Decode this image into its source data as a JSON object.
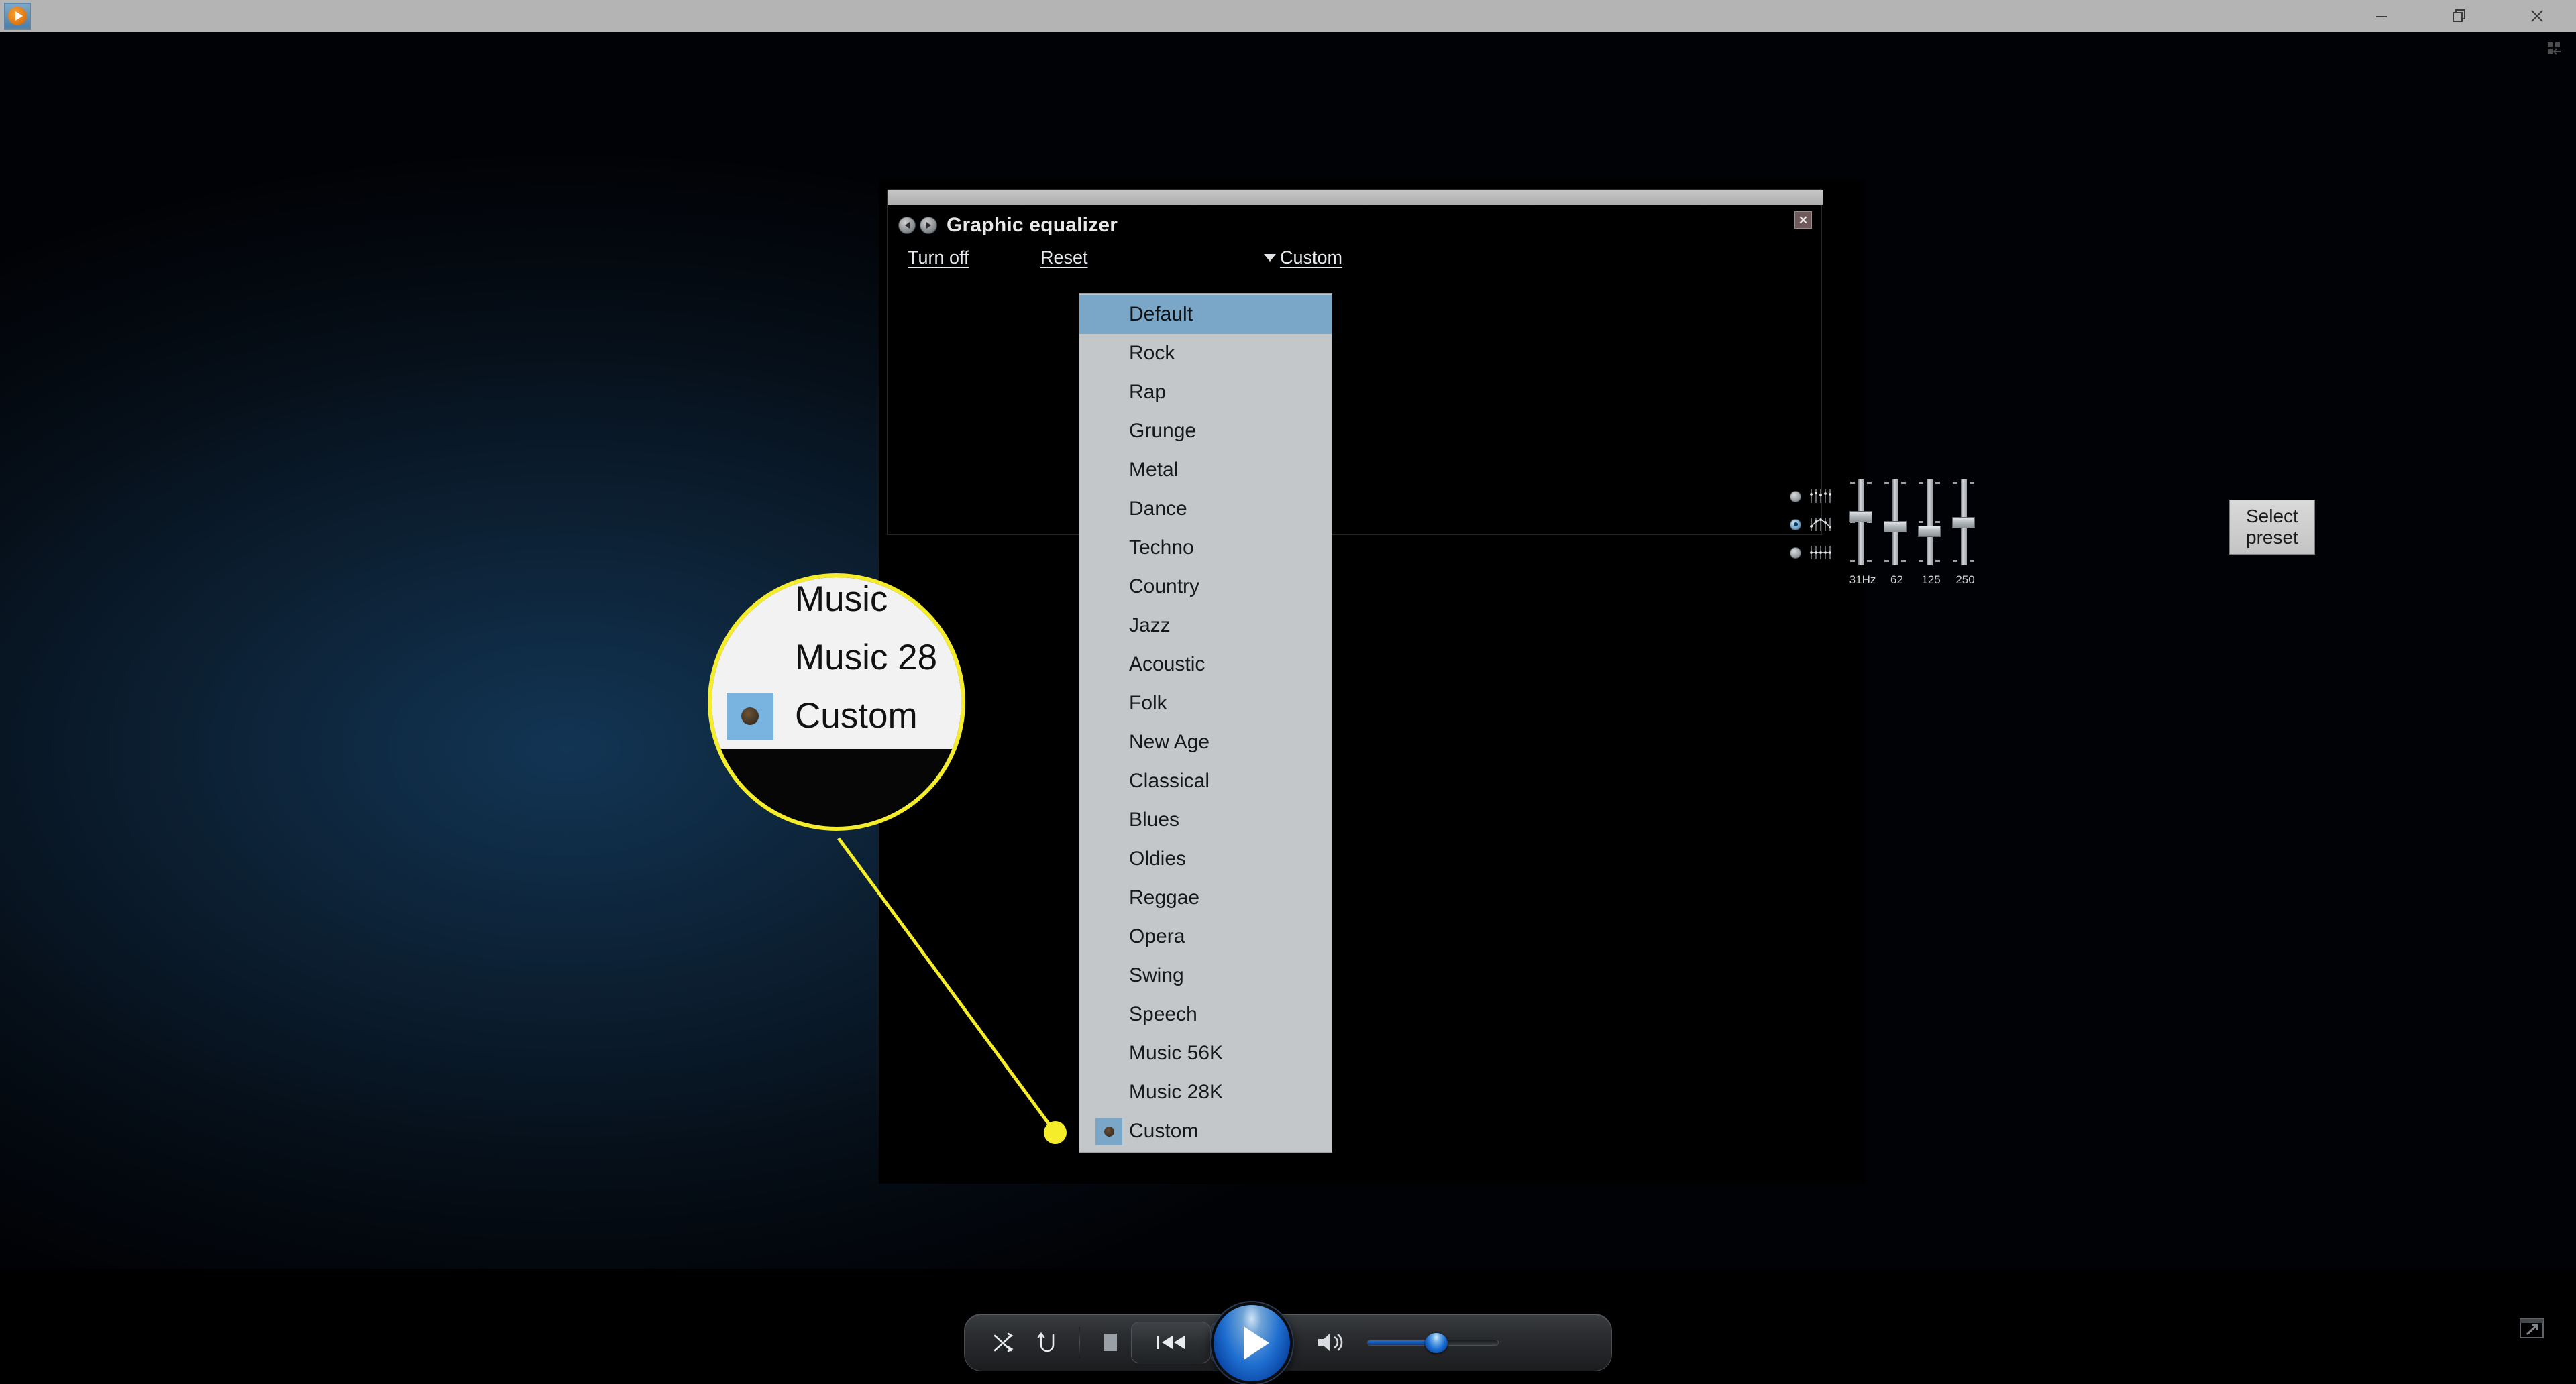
{
  "titlebar": {
    "app_icon": "media-player-icon",
    "minimize_label": "—",
    "restore_label": "❐",
    "close_label": "✕"
  },
  "equalizer": {
    "title": "Graphic equalizer",
    "nav_prev_icon": "chevron-left-circle-icon",
    "nav_next_icon": "chevron-right-circle-icon",
    "close_label": "✕",
    "turn_off_label": "Turn off",
    "reset_label": "Reset",
    "selected_preset": "Custom",
    "select_preset_button": "Select preset",
    "mode_radios": [
      {
        "name": "independent-sliders",
        "selected": false
      },
      {
        "name": "loose-sliders",
        "selected": true
      },
      {
        "name": "tight-sliders",
        "selected": false
      }
    ],
    "bands": [
      {
        "label": "31Hz",
        "thumb_pct": 42
      },
      {
        "label": "62",
        "thumb_pct": 55
      },
      {
        "label": "125",
        "thumb_pct": 62
      },
      {
        "label": "250",
        "thumb_pct": 50
      }
    ]
  },
  "preset_dropdown": {
    "highlighted": "Default",
    "checked": "Custom",
    "items": [
      "Default",
      "Rock",
      "Rap",
      "Grunge",
      "Metal",
      "Dance",
      "Techno",
      "Country",
      "Jazz",
      "Acoustic",
      "Folk",
      "New Age",
      "Classical",
      "Blues",
      "Oldies",
      "Reggae",
      "Opera",
      "Swing",
      "Speech",
      "Music 56K",
      "Music 28K",
      "Custom"
    ]
  },
  "callout": {
    "line1": "Music",
    "line2": "Music 28",
    "line3": "Custom",
    "accent_color": "#f5ec2a"
  },
  "player_controls": {
    "shuffle_icon": "shuffle-icon",
    "repeat_icon": "repeat-icon",
    "stop_icon": "stop-icon",
    "previous_icon": "previous-track-icon",
    "play_icon": "play-icon",
    "next_icon": "next-track-icon",
    "mute_icon": "volume-speaker-icon",
    "volume_level": 50,
    "switch_mode_icon": "switch-to-library-icon"
  },
  "colors": {
    "titlebar_bg": "#b4b4b4",
    "stage_bg": "#0c2033",
    "panel_bg": "#000000",
    "dropdown_bg": "#c3c7ca",
    "highlight_blue": "#7aa7c7",
    "accent_yellow": "#f5ec2a",
    "play_blue": "#1f6fd0"
  }
}
